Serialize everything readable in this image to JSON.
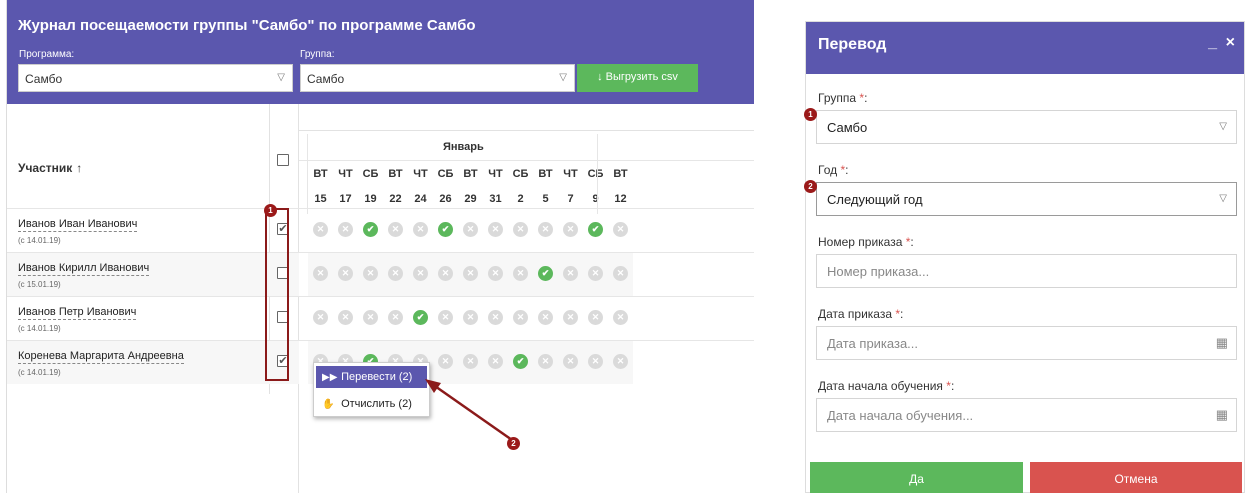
{
  "journal": {
    "title": "Журнал посещаемости группы \"Самбо\" по программе Самбо",
    "program_label": "Программа:",
    "program_value": "Самбо",
    "group_label": "Группа:",
    "group_value": "Самбо",
    "csv_button": "Выгрузить csv",
    "participant_header": "Участник",
    "sort_icon": "↑",
    "month": "Январь",
    "days": [
      {
        "name": "ВТ",
        "num": "15"
      },
      {
        "name": "ЧТ",
        "num": "17"
      },
      {
        "name": "СБ",
        "num": "19"
      },
      {
        "name": "ВТ",
        "num": "22"
      },
      {
        "name": "ЧТ",
        "num": "24"
      },
      {
        "name": "СБ",
        "num": "26"
      },
      {
        "name": "ВТ",
        "num": "29"
      },
      {
        "name": "ЧТ",
        "num": "31"
      },
      {
        "name": "СБ",
        "num": "2"
      },
      {
        "name": "ВТ",
        "num": "5"
      },
      {
        "name": "ЧТ",
        "num": "7"
      },
      {
        "name": "СБ",
        "num": "9"
      },
      {
        "name": "ВТ",
        "num": "12"
      }
    ],
    "participants": [
      {
        "name": "Иванов Иван Иванович",
        "since": "(с 14.01.19)",
        "checked": true,
        "attendance": [
          0,
          0,
          1,
          0,
          0,
          1,
          0,
          0,
          0,
          0,
          0,
          1,
          0
        ]
      },
      {
        "name": "Иванов Кирилл Иванович",
        "since": "(с 15.01.19)",
        "checked": false,
        "attendance": [
          0,
          0,
          0,
          0,
          0,
          0,
          0,
          0,
          0,
          1,
          0,
          0,
          0
        ]
      },
      {
        "name": "Иванов Петр Иванович",
        "since": "(с 14.01.19)",
        "checked": false,
        "attendance": [
          0,
          0,
          0,
          0,
          1,
          0,
          0,
          0,
          0,
          0,
          0,
          0,
          0
        ]
      },
      {
        "name": "Коренева Маргарита Андреевна",
        "since": "(с 14.01.19)",
        "checked": true,
        "attendance": [
          0,
          0,
          1,
          0,
          0,
          0,
          0,
          0,
          1,
          0,
          0,
          0,
          0
        ]
      }
    ],
    "context_menu": {
      "transfer": "Перевести (2)",
      "expel": "Отчислить (2)"
    },
    "badge_1": "1",
    "badge_2": "2"
  },
  "dialog": {
    "title": "Перевод",
    "minimize": "_",
    "close": "×",
    "group_label": "Группа",
    "group_value": "Самбо",
    "year_label": "Год",
    "year_value": "Следующий год",
    "order_number_label": "Номер приказа",
    "order_number_placeholder": "Номер приказа...",
    "order_date_label": "Дата приказа",
    "order_date_placeholder": "Дата приказа...",
    "start_date_label": "Дата начала обучения",
    "start_date_placeholder": "Дата начала обучения...",
    "required_mark": "*",
    "colon": ":",
    "yes_button": "Да",
    "cancel_button": "Отмена",
    "badge_1": "1",
    "badge_2": "2"
  },
  "colors": {
    "header": "#5b57ae",
    "green": "#5cb85c",
    "red": "#d9534f",
    "annotation": "#9b1a1a",
    "absent_mark": "#dadada"
  },
  "icons": {
    "check_mark": "✔",
    "absent_mark": "✕",
    "download": "↓",
    "dropdown": "▽",
    "calendar": "▦",
    "transfer": "▶▶",
    "expel": "✋"
  }
}
